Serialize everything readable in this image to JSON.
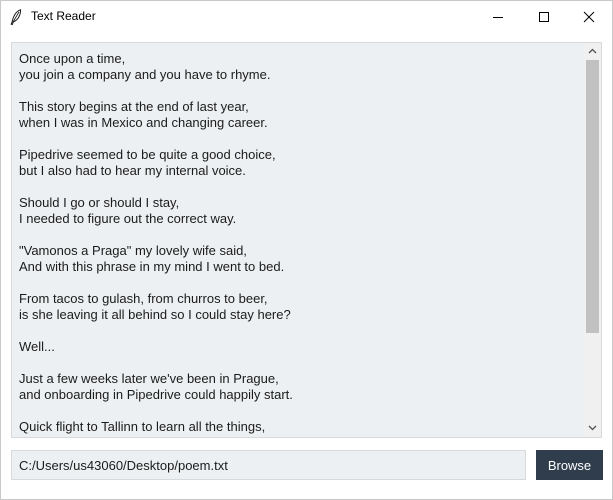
{
  "window": {
    "title": "Text Reader",
    "icon": "feather-icon",
    "controls": {
      "minimize": "minimize-icon",
      "maximize": "maximize-icon",
      "close": "close-icon"
    }
  },
  "reader": {
    "lines": [
      "Once upon a time,",
      "you join a company and you have to rhyme.",
      "",
      "This story begins at the end of last year,",
      "when I was in Mexico and changing career.",
      "",
      "Pipedrive seemed to be quite a good choice,",
      "but I also had to hear my internal voice.",
      "",
      "Should I go or should I stay,",
      "I needed to figure out the correct way.",
      "",
      "\"Vamonos a Praga\" my lovely wife said,",
      "And with this phrase in my mind I went to bed.",
      "",
      "From tacos to gulash, from churros to beer,",
      "is she leaving it all behind so I could stay here?",
      "",
      "Well...",
      "",
      "Just a few weeks later we've been in Prague,",
      "and onboarding in Pipedrive could happily start.",
      "",
      "Quick flight to Tallinn to learn all the things,"
    ],
    "scroll_position": 0
  },
  "file": {
    "path": "C:/Users/us43060/Desktop/poem.txt",
    "browse_label": "Browse"
  },
  "colors": {
    "text_bg": "#edf0f2",
    "button_bg": "#2f3d4c",
    "button_text": "#ffffff"
  }
}
